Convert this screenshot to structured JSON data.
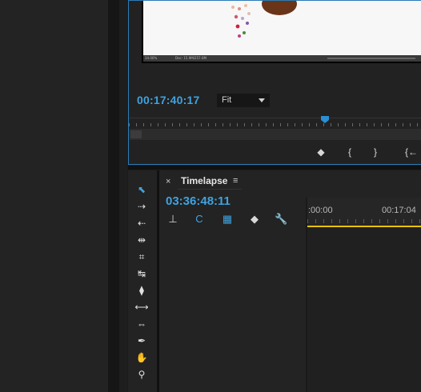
{
  "program_monitor": {
    "frame_footer": {
      "left_text": "34.00%",
      "doc_text": "Doc: 15.9M/257.6M"
    },
    "timecode": "00:17:40:17",
    "zoom": {
      "value": "Fit"
    },
    "controls": {
      "marker_icon": "marker-icon",
      "in_icon": "mark-in-icon",
      "out_icon": "mark-out-icon",
      "goto_in_icon": "go-to-in-icon",
      "marker_glyph": "◆",
      "in_glyph": "{",
      "out_glyph": "}",
      "goto_in_glyph": "{←"
    }
  },
  "tools": [
    {
      "name": "selection-tool-icon",
      "glyph": "⬉"
    },
    {
      "name": "track-select-forward-icon",
      "glyph": "⇢"
    },
    {
      "name": "track-select-backward-icon",
      "glyph": "⇠"
    },
    {
      "name": "ripple-edit-icon",
      "glyph": "⇹"
    },
    {
      "name": "rolling-edit-icon",
      "glyph": "⌗"
    },
    {
      "name": "rate-stretch-icon",
      "glyph": "↹"
    },
    {
      "name": "razor-icon",
      "glyph": "⧫"
    },
    {
      "name": "slip-icon",
      "glyph": "⟷"
    },
    {
      "name": "slide-icon",
      "glyph": "⇔"
    },
    {
      "name": "pen-icon",
      "glyph": "✒"
    },
    {
      "name": "hand-icon",
      "glyph": "✋"
    },
    {
      "name": "zoom-icon",
      "glyph": "⚲"
    }
  ],
  "timeline": {
    "close_glyph": "×",
    "tab_label": "Timelapse",
    "menu_glyph": "≡",
    "timecode": "03:36:48:11",
    "buttons": [
      {
        "name": "snap-icon",
        "glyph": "⊥",
        "color": "#d8d8d8"
      },
      {
        "name": "linked-selection-icon",
        "glyph": "C",
        "color": "#3ea3e0"
      },
      {
        "name": "add-marker-icon",
        "glyph": "▦",
        "color": "#3ea3e0"
      },
      {
        "name": "marker-icon",
        "glyph": "◆",
        "color": "#d8d8d8"
      },
      {
        "name": "wrench-icon",
        "glyph": "🔧",
        "color": "#d8d8d8"
      }
    ],
    "ruler_labels": [
      ":00:00",
      "00:17:04"
    ],
    "work_area_color": "#e8c400"
  },
  "accent_color": "#3ea3e0"
}
